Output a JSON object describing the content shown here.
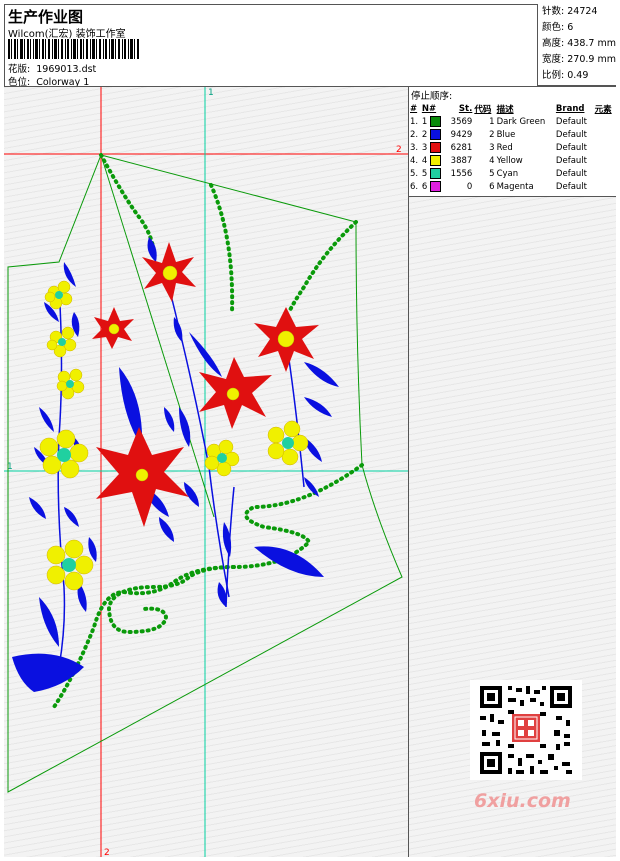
{
  "header": {
    "title": "生产作业图",
    "company": "Wilcom(汇宏) 装饰工作室",
    "design_label": "花版:",
    "design_value": "1969013.dst",
    "colorway_label": "色位:",
    "colorway_value": "Colorway 1"
  },
  "stats": [
    {
      "label": "针数:",
      "value": "24724"
    },
    {
      "label": "颜色:",
      "value": "6"
    },
    {
      "label": "高度:",
      "value": "438.7 mm"
    },
    {
      "label": "宽度:",
      "value": "270.9 mm"
    },
    {
      "label": "比例:",
      "value": "0.49"
    }
  ],
  "stop_table": {
    "title": "停止顺序:",
    "columns": [
      "#",
      "N#",
      "St.",
      "代码",
      "描述",
      "Brand",
      "元素"
    ],
    "rows": [
      {
        "idx": "1.",
        "n": "1",
        "color": "#0a8a0a",
        "st": "3569",
        "code": "1",
        "desc": "Dark Green",
        "brand": "Default"
      },
      {
        "idx": "2.",
        "n": "2",
        "color": "#0a10e0",
        "st": "9429",
        "code": "2",
        "desc": "Blue",
        "brand": "Default"
      },
      {
        "idx": "3.",
        "n": "3",
        "color": "#e01010",
        "st": "6281",
        "code": "3",
        "desc": "Red",
        "brand": "Default"
      },
      {
        "idx": "4.",
        "n": "4",
        "color": "#f0f000",
        "st": "3887",
        "code": "4",
        "desc": "Yellow",
        "brand": "Default"
      },
      {
        "idx": "5.",
        "n": "5",
        "color": "#20d0a0",
        "st": "1556",
        "code": "5",
        "desc": "Cyan",
        "brand": "Default"
      },
      {
        "idx": "6.",
        "n": "6",
        "color": "#e020e0",
        "st": "0",
        "code": "6",
        "desc": "Magenta",
        "brand": "Default"
      }
    ]
  },
  "guides": {
    "top_label": "1",
    "right_label": "2",
    "left_label": "1",
    "bottom_label": "2"
  },
  "watermark": "6xiu.com",
  "colors": {
    "green": "#0a9a0a",
    "blue": "#0a10e0",
    "red": "#e01010",
    "yellow": "#f0f000",
    "cyan": "#20d0a0",
    "guide_red": "#ff0000",
    "guide_cyan": "#00d0a0"
  },
  "icons": {
    "qr": "qr-code-icon",
    "seal": "seal-stamp-icon"
  }
}
